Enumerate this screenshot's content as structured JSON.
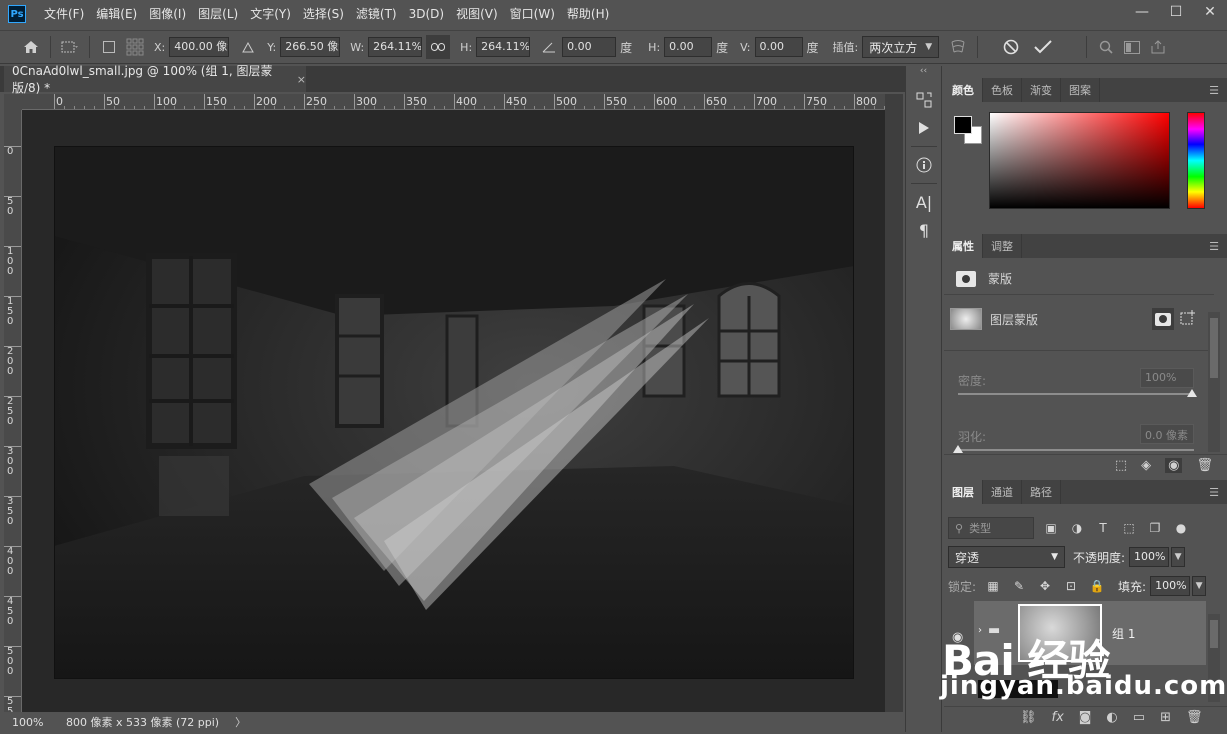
{
  "app": {
    "logo_text": "Ps",
    "menu": [
      "文件(F)",
      "编辑(E)",
      "图像(I)",
      "图层(L)",
      "文字(Y)",
      "选择(S)",
      "滤镜(T)",
      "3D(D)",
      "视图(V)",
      "窗口(W)",
      "帮助(H)"
    ],
    "window_controls": {
      "minimize": "—",
      "maximize": "☐",
      "close": "✕"
    }
  },
  "options": {
    "x_label": "X:",
    "x_value": "400.00 像素",
    "y_label": "Y:",
    "y_value": "266.50 像素",
    "w_label": "W:",
    "w_value": "264.11%",
    "h_label": "H:",
    "h_value": "264.11%",
    "angle_value": "0.00",
    "angle_unit": "度",
    "hskew_label": "H:",
    "hskew_value": "0.00",
    "hskew_unit": "度",
    "vskew_label": "V:",
    "vskew_value": "0.00",
    "vskew_unit": "度",
    "interp_label": "插值:",
    "interp_value": "两次立方"
  },
  "document": {
    "tab_title": "0CnaAd0lwl_small.jpg @ 100% (组 1, 图层蒙版/8) *",
    "close_glyph": "×",
    "ruler_top": [
      "0",
      "50",
      "100",
      "150",
      "200",
      "250",
      "300",
      "350",
      "400",
      "450",
      "500",
      "550",
      "600",
      "650",
      "700",
      "750",
      "800"
    ],
    "ruler_left": [
      "0",
      "5\n0",
      "1\n0\n0",
      "1\n5\n0",
      "2\n0\n0",
      "2\n5\n0",
      "3\n0\n0",
      "3\n5\n0",
      "4\n0\n0",
      "4\n5\n0",
      "5\n0\n0",
      "5\n5\n0"
    ]
  },
  "status": {
    "zoom": "100%",
    "info": "800 像素 x 533 像素 (72 ppi)",
    "arrow": "〉"
  },
  "color_panel": {
    "tabs": [
      "颜色",
      "色板",
      "渐变",
      "图案"
    ],
    "active_tab": 0,
    "field_hue": "#ff0000"
  },
  "properties_panel": {
    "tabs": [
      "属性",
      "调整"
    ],
    "header": "蒙版",
    "mask_label": "图层蒙版",
    "density_label": "密度:",
    "density_value": "100%",
    "feather_label": "羽化:",
    "feather_value": "0.0 像素"
  },
  "layers_panel": {
    "tabs": [
      "图层",
      "通道",
      "路径"
    ],
    "search_placeholder": "类型",
    "blend_mode": "穿透",
    "opacity_label": "不透明度:",
    "opacity_value": "100%",
    "lock_label": "锁定:",
    "fill_label": "填充:",
    "fill_value": "100%",
    "layer_name": "组 1"
  },
  "watermark": {
    "brand": "Bai  经验",
    "url": "jingyan.baidu.com"
  }
}
